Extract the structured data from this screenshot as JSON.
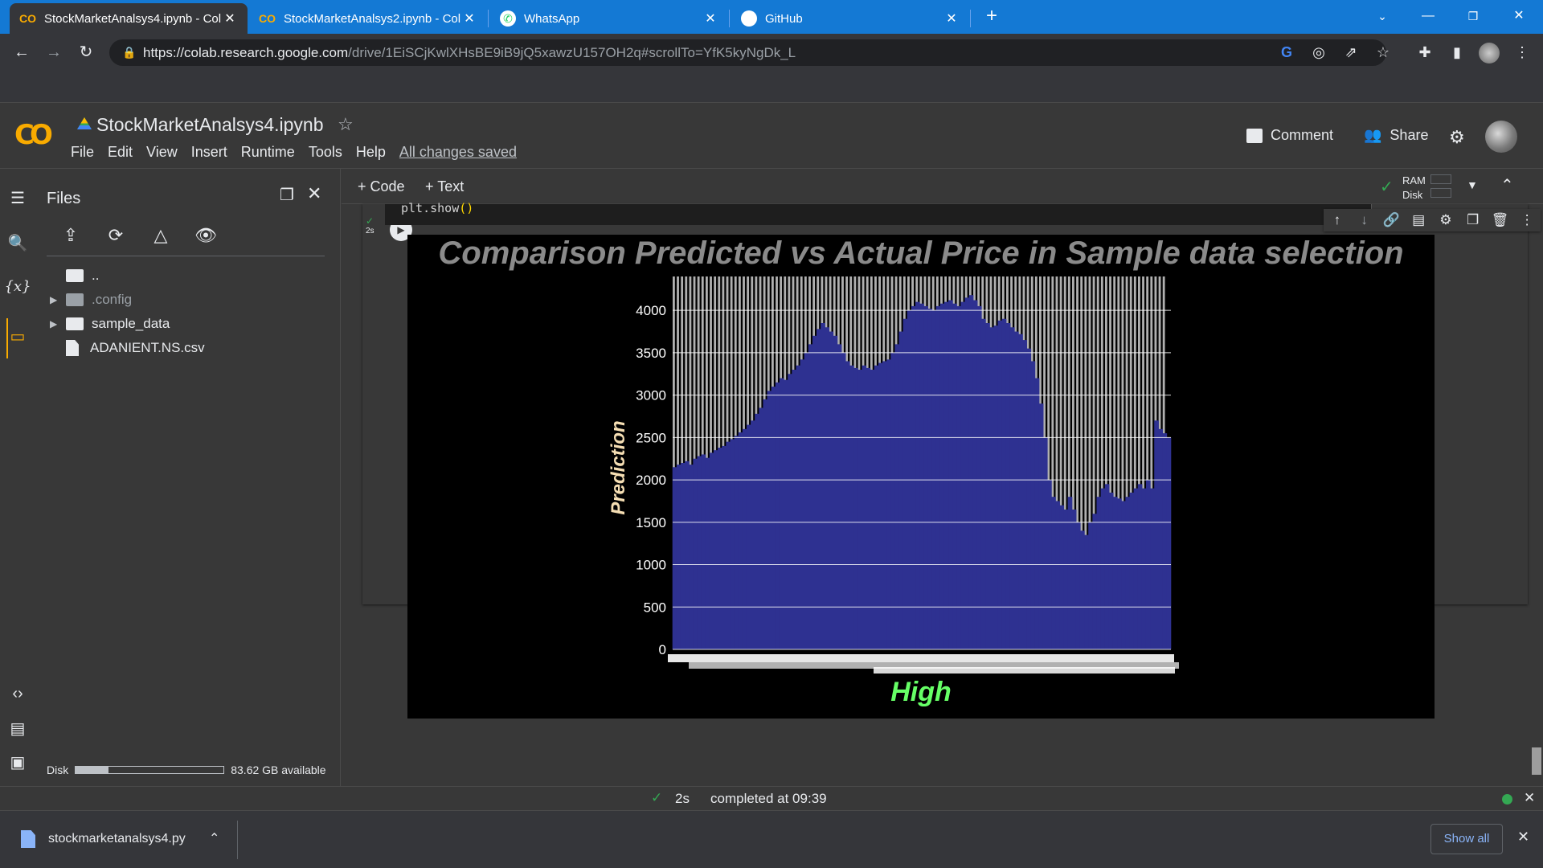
{
  "browser": {
    "tabs": [
      {
        "title": "StockMarketAnalsys4.ipynb - Col",
        "active": true,
        "icon": "colab-icon"
      },
      {
        "title": "StockMarketAnalsys2.ipynb - Col",
        "active": false,
        "icon": "colab-icon"
      },
      {
        "title": "WhatsApp",
        "active": false,
        "icon": "whatsapp-icon"
      },
      {
        "title": "GitHub",
        "active": false,
        "icon": "github-icon"
      }
    ],
    "url_host": "https://colab.research.google.com",
    "url_path": "/drive/1EiSCjKwlXHsBE9iB9jQ5xawzU157OH2q#scrollTo=YfK5kyNgDk_L"
  },
  "colab": {
    "notebook_title": "StockMarketAnalsys4.ipynb",
    "menu": [
      "File",
      "Edit",
      "View",
      "Insert",
      "Runtime",
      "Tools",
      "Help"
    ],
    "saved_status": "All changes saved",
    "comment_label": "Comment",
    "share_label": "Share",
    "add_code_label": "+ Code",
    "add_text_label": "+ Text",
    "ram_label": "RAM",
    "disk_label": "Disk"
  },
  "files_panel": {
    "title": "Files",
    "items": [
      {
        "name": "..",
        "type": "up"
      },
      {
        "name": ".config",
        "type": "folder",
        "dim": true
      },
      {
        "name": "sample_data",
        "type": "folder",
        "dim": false
      },
      {
        "name": "ADANIENT.NS.csv",
        "type": "file",
        "dim": false
      }
    ],
    "disk_label": "Disk",
    "disk_available": "83.62 GB available",
    "disk_used_fraction": 0.22
  },
  "cell": {
    "code": "plt.show",
    "code_paren": "()",
    "exec_time": "2s"
  },
  "status": {
    "time": "2s",
    "completed": "completed at 09:39"
  },
  "downloads": {
    "file": "stockmarketanalsys4.py",
    "show_all": "Show all"
  },
  "colors": {
    "actual_bar": "#b0b0b0",
    "pred_fill": "#2e3191",
    "title": "#8a8a8a",
    "xlabel": "#66ff66",
    "ylabel": "#f5deb3"
  },
  "chart_data": {
    "type": "bar",
    "title": "Comparison Predicted vs Actual Price in Sample data selection",
    "xlabel": "High",
    "ylabel": "Prediction",
    "ylim": [
      0,
      4400
    ],
    "yticks": [
      0,
      500,
      1000,
      1500,
      2000,
      2500,
      3000,
      3500,
      4000
    ],
    "grid": true,
    "series": [
      {
        "values": [
          4400,
          4400,
          4400,
          4400,
          4400,
          4400,
          4400,
          4400,
          4400,
          4400,
          4400,
          4400,
          4400,
          4400,
          4400,
          4400,
          4400,
          4400,
          4400,
          4400,
          4400,
          4400,
          4400,
          4400,
          4400,
          4400,
          4400,
          4400,
          4400,
          4400,
          4400,
          4400,
          4400,
          4400,
          4400,
          4400,
          4400,
          4400,
          4400,
          4400,
          4400,
          4400,
          4400,
          4400,
          4400,
          4400,
          4400,
          4400,
          4400,
          4400,
          4400,
          4400,
          4400,
          4400,
          4400,
          4400,
          4400,
          4400,
          4400,
          4400,
          4400,
          4400,
          4400,
          4400,
          4400,
          4400,
          4400,
          4400,
          4400,
          4400,
          4400,
          4400,
          4400,
          4400,
          4400,
          4400,
          4400,
          4400,
          4400,
          4400,
          4400,
          4400,
          4400,
          4400,
          4400,
          4400,
          4400,
          4400,
          4400,
          4400,
          4400,
          4400,
          4400,
          4400,
          4400,
          4400,
          4400,
          4400,
          4400,
          4400,
          4400,
          4400,
          4400,
          4400,
          4400,
          4400,
          4400,
          4400,
          4400,
          4400,
          4400,
          4400,
          4400,
          4400,
          4400,
          4400,
          4400,
          4400,
          4400,
          4400
        ]
      },
      {
        "values": [
          2150,
          2180,
          2200,
          2220,
          2180,
          2250,
          2280,
          2300,
          2260,
          2320,
          2350,
          2380,
          2400,
          2450,
          2480,
          2520,
          2560,
          2600,
          2650,
          2700,
          2780,
          2850,
          2950,
          3050,
          3100,
          3150,
          3200,
          3180,
          3250,
          3300,
          3350,
          3420,
          3500,
          3600,
          3700,
          3780,
          3850,
          3800,
          3750,
          3700,
          3600,
          3500,
          3400,
          3350,
          3320,
          3300,
          3350,
          3320,
          3300,
          3350,
          3380,
          3400,
          3420,
          3500,
          3600,
          3750,
          3900,
          4000,
          4050,
          4100,
          4080,
          4050,
          4020,
          4000,
          4050,
          4080,
          4100,
          4120,
          4080,
          4050,
          4100,
          4150,
          4180,
          4120,
          4050,
          3900,
          3850,
          3800,
          3820,
          3880,
          3900,
          3850,
          3800,
          3750,
          3720,
          3650,
          3550,
          3400,
          3200,
          2900,
          2500,
          2000,
          1800,
          1750,
          1700,
          1650,
          1800,
          1650,
          1500,
          1400,
          1350,
          1500,
          1600,
          1800,
          1900,
          1950,
          1850,
          1800,
          1780,
          1750,
          1800,
          1850,
          1900,
          1950,
          1900,
          2000,
          1900,
          2700,
          2600,
          2550,
          2500
        ]
      }
    ],
    "categories_count": 120
  }
}
